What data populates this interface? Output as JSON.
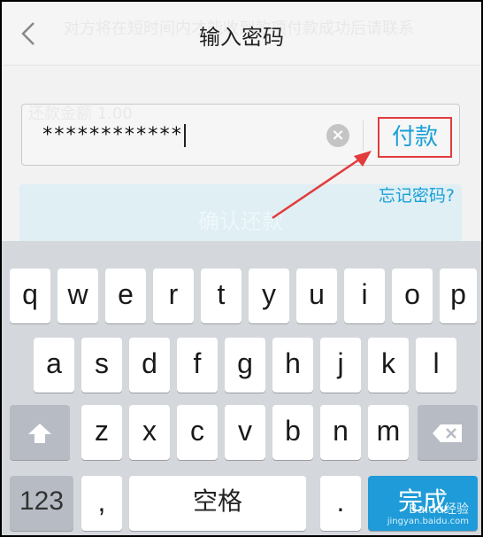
{
  "header": {
    "title": "输入密码",
    "ghost_text": "对方将在短时间内才能收到款项付款成功后请联系"
  },
  "background": {
    "amount_label": "还款金额 1.00",
    "confirm_label": "确认还款"
  },
  "password_field": {
    "value": "************",
    "clear_icon": "clear-icon"
  },
  "pay_button_label": "付款",
  "forgot_password_label": "忘记密码?",
  "keyboard": {
    "row1": [
      "q",
      "w",
      "e",
      "r",
      "t",
      "y",
      "u",
      "i",
      "o",
      "p"
    ],
    "row2": [
      "a",
      "s",
      "d",
      "f",
      "g",
      "h",
      "j",
      "k",
      "l"
    ],
    "row3": [
      "z",
      "x",
      "c",
      "v",
      "b",
      "n",
      "m"
    ],
    "shift_icon": "shift-icon",
    "backspace_icon": "backspace-icon",
    "num_label": "123",
    "comma_label": ",",
    "space_label": "空格",
    "period_label": ".",
    "done_label": "完成"
  },
  "watermark": {
    "line1": "Baidu经验",
    "line2": "jingyan.baidu.com"
  },
  "colors": {
    "accent": "#1aa0d8",
    "highlight_border": "#e23c3c",
    "keyboard_bg": "#d4d7dc"
  }
}
